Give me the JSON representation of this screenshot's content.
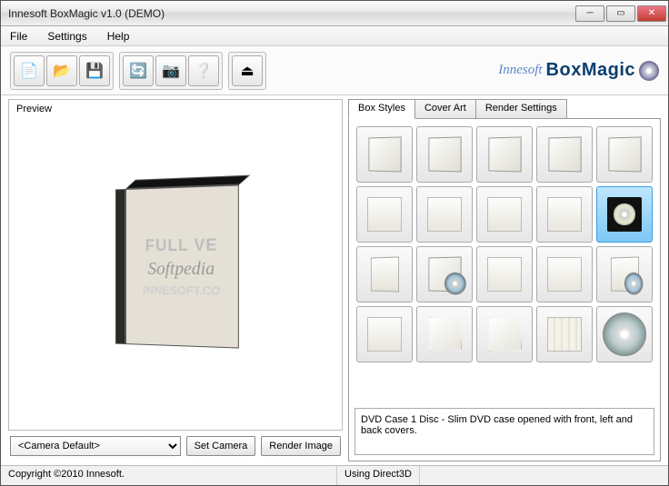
{
  "window": {
    "title": "Innesoft BoxMagic v1.0 (DEMO)"
  },
  "menu": {
    "file": "File",
    "settings": "Settings",
    "help": "Help"
  },
  "toolbar": {
    "icons": {
      "new": "new-icon",
      "open": "open-icon",
      "save": "save-icon",
      "refresh": "refresh-icon",
      "snapshot": "camera-icon",
      "help": "help-icon",
      "exit": "exit-icon"
    }
  },
  "brand": {
    "company": "Innesoft",
    "product": "BoxMagic"
  },
  "preview": {
    "label": "Preview",
    "watermark1": "FULL VE",
    "watermark2": "Softpedia",
    "watermark3": "INNESOFT.CO"
  },
  "controls": {
    "camera_default": "<Camera Default>",
    "set_camera": "Set Camera",
    "render_image": "Render Image"
  },
  "tabs": {
    "box_styles": "Box Styles",
    "cover_art": "Cover Art",
    "render_settings": "Render Settings"
  },
  "styles": {
    "selected_index": 9,
    "description": "DVD Case 1 Disc - Slim DVD case opened with front, left and back covers.",
    "items": [
      {
        "name": "software-box-1",
        "cls": "t-box"
      },
      {
        "name": "software-box-2",
        "cls": "t-box"
      },
      {
        "name": "software-box-3",
        "cls": "t-box"
      },
      {
        "name": "software-box-4",
        "cls": "t-box"
      },
      {
        "name": "software-box-thick",
        "cls": "t-box"
      },
      {
        "name": "flat-cover-1",
        "cls": "t-flat"
      },
      {
        "name": "flat-cover-2",
        "cls": "t-flat"
      },
      {
        "name": "flat-cover-3",
        "cls": "t-flat"
      },
      {
        "name": "flat-cover-4",
        "cls": "t-flat"
      },
      {
        "name": "dvd-case-1-disc",
        "cls": "t-dvd"
      },
      {
        "name": "thin-box-1",
        "cls": "t-thin"
      },
      {
        "name": "box-with-discs",
        "cls": "t-box disc-overlay"
      },
      {
        "name": "flat-square-1",
        "cls": "t-flat"
      },
      {
        "name": "flat-square-2",
        "cls": "t-flat"
      },
      {
        "name": "thin-with-disc",
        "cls": "t-thin disc-overlay"
      },
      {
        "name": "flat-panel",
        "cls": "t-flat"
      },
      {
        "name": "curved-sheet",
        "cls": "t-curl"
      },
      {
        "name": "bowtie-sheet",
        "cls": "t-curl"
      },
      {
        "name": "striped-booklet",
        "cls": "t-stripe"
      },
      {
        "name": "disc-only",
        "cls": "t-disc"
      }
    ]
  },
  "status": {
    "copyright": "Copyright ©2010 Innesoft.",
    "engine": "Using Direct3D"
  }
}
